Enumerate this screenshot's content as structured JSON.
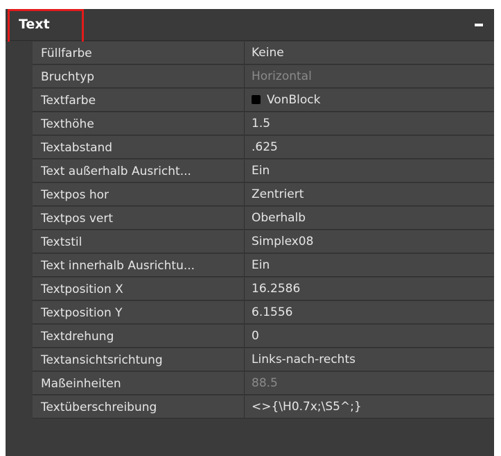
{
  "section": {
    "title": "Text"
  },
  "properties": [
    {
      "name": "Füllfarbe",
      "value": "Keine",
      "disabled": false
    },
    {
      "name": "Bruchtyp",
      "value": "Horizontal",
      "disabled": true
    },
    {
      "name": "Textfarbe",
      "value": "VonBlock",
      "disabled": false,
      "swatch": "#000000"
    },
    {
      "name": "Texthöhe",
      "value": "1.5",
      "disabled": false
    },
    {
      "name": "Textabstand",
      "value": ".625",
      "disabled": false
    },
    {
      "name": "Text außerhalb Ausricht...",
      "value": "Ein",
      "disabled": false
    },
    {
      "name": "Textpos hor",
      "value": "Zentriert",
      "disabled": false
    },
    {
      "name": "Textpos vert",
      "value": "Oberhalb",
      "disabled": false
    },
    {
      "name": "Textstil",
      "value": "Simplex08",
      "disabled": false
    },
    {
      "name": "Text innerhalb Ausrichtu...",
      "value": "Ein",
      "disabled": false
    },
    {
      "name": "Textposition X",
      "value": "16.2586",
      "disabled": false
    },
    {
      "name": "Textposition Y",
      "value": "6.1556",
      "disabled": false
    },
    {
      "name": "Textdrehung",
      "value": "0",
      "disabled": false
    },
    {
      "name": "Textansichtsrichtung",
      "value": "Links-nach-rechts",
      "disabled": false
    },
    {
      "name": "Maßeinheiten",
      "value": "88.5",
      "disabled": true
    },
    {
      "name": "Textüberschreibung",
      "value": "<>{\\H0.7x;\\S5^;}",
      "disabled": false
    }
  ],
  "colors": {
    "panel_bg": "#3b3b3b",
    "row_bg": "#464646",
    "text": "#e6e6e6",
    "disabled_text": "#8a8a8a",
    "highlight": "#e31b1b"
  },
  "icons": {
    "collapse": "minus-icon",
    "color_swatch": "color-swatch-icon"
  }
}
